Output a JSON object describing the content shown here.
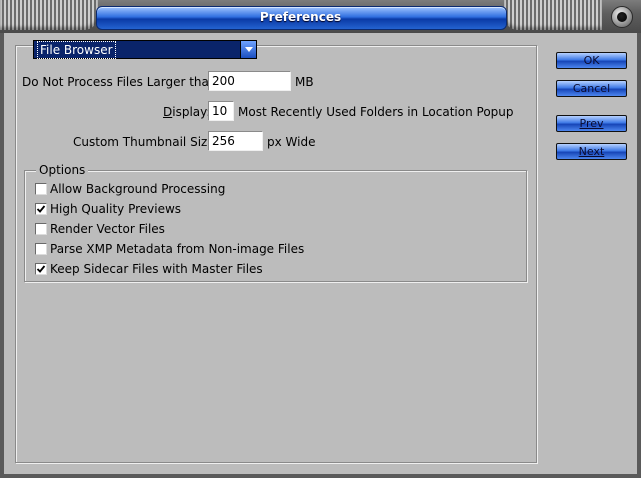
{
  "window": {
    "title": "Preferences"
  },
  "section_dropdown": {
    "value": "File Browser"
  },
  "fields": {
    "max_file_size": {
      "label": "Do Not Process Files Larger than:",
      "value": "200",
      "unit": "MB"
    },
    "display": {
      "label": "Display:",
      "value": "10",
      "suffix": "Most Recently Used Folders in Location Popup"
    },
    "thumbnail": {
      "label": "Custom Thumbnail Size:",
      "value": "256",
      "suffix": "px Wide"
    }
  },
  "options": {
    "legend": "Options",
    "items": [
      {
        "label": "Allow Background Processing",
        "checked": false
      },
      {
        "label": "High Quality Previews",
        "checked": true
      },
      {
        "label": "Render Vector Files",
        "checked": false
      },
      {
        "label": "Parse XMP Metadata from Non-image Files",
        "checked": false
      },
      {
        "label": "Keep Sidecar Files with Master Files",
        "checked": true
      }
    ]
  },
  "buttons": {
    "ok": "OK",
    "cancel": "Cancel",
    "prev": "Prev",
    "next": "Next"
  },
  "colors": {
    "face": "#bcbcbc",
    "accent": "#2f6fe0",
    "selection": "#0a246a"
  }
}
